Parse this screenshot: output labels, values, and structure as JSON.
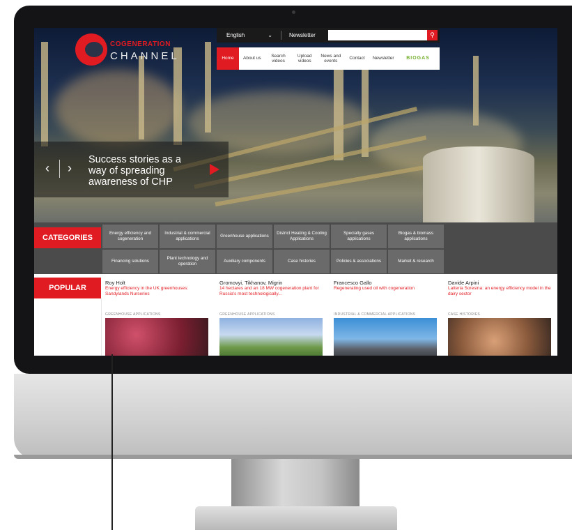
{
  "site": {
    "logo_top": "COGENERATION",
    "logo_bottom": "CHANNEL"
  },
  "topbar": {
    "language": "English",
    "newsletter": "Newsletter",
    "search_placeholder": ""
  },
  "nav": {
    "items": [
      "Home",
      "About us",
      "Search videos",
      "Upload videos",
      "News and events",
      "Contact",
      "Newsletter"
    ],
    "partner_logo": "BIOGAS"
  },
  "slider": {
    "headline": "Success stories as a way of spreading awareness of CHP"
  },
  "categories": {
    "label": "CATEGORIES",
    "row1": [
      "Energy efficiency and cogeneration",
      "Industrial & commercial applications",
      "Greenhouse applications",
      "District Heating & Cooling Applications",
      "Specialty gases applications",
      "Biogas & biomass applications"
    ],
    "row2": [
      "Financing solutions",
      "Plant technology and operation",
      "Auxiliary components",
      "Case histories",
      "Policies & associations",
      "Market & research"
    ]
  },
  "popular": {
    "label": "POPULAR",
    "cards": [
      {
        "author": "Roy Holt",
        "title": "Energy efficiency in the UK greenhouses: Sandylands Nurseries",
        "category": "GREENHOUSE APPLICATIONS"
      },
      {
        "author": "Gromovyi, Tikhanov, Migrin",
        "title": "14 hectares and an 18 MW cogeneration plant for Russia's most technologically...",
        "category": "GREENHOUSE APPLICATIONS"
      },
      {
        "author": "Francesco Gallo",
        "title": "Regenerating used oil with cogeneration",
        "category": "INDUSTRIAL & COMMERCIAL APPLICATIONS"
      },
      {
        "author": "Davide Arpini",
        "title": "Latteria Soresina: an energy efficiency model in the dairy sector",
        "category": "CASE HISTORIES"
      }
    ]
  },
  "colors": {
    "accent": "#e11b22",
    "category_bg": "#4b4b4b",
    "category_button": "#6a6a6a",
    "topbar": "#1a1a1a",
    "biogas_green": "#77b130"
  }
}
